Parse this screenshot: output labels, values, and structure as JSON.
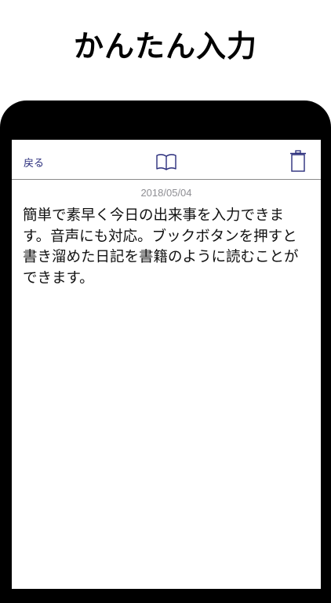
{
  "headline": "かんたん入力",
  "navbar": {
    "back_label": "戻る",
    "book_icon": "book-icon",
    "trash_icon": "trash-icon",
    "accent_color": "#2a2d7c"
  },
  "entry": {
    "date": "2018/05/04",
    "text": "簡単で素早く今日の出来事を入力できます。音声にも対応。ブックボタンを押すと書き溜めた日記を書籍のように読むことができます。"
  }
}
